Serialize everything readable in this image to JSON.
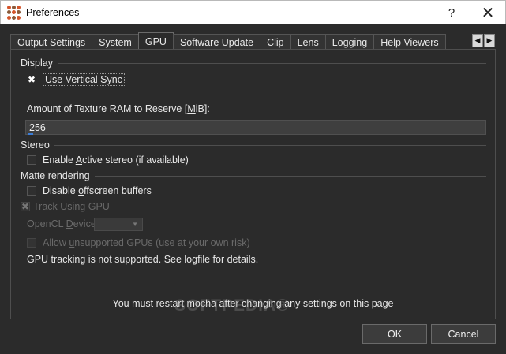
{
  "window": {
    "title": "Preferences",
    "help_glyph": "?",
    "close_glyph": "✕"
  },
  "tabs": [
    {
      "label": "Output Settings",
      "active": false
    },
    {
      "label": "System",
      "active": false
    },
    {
      "label": "GPU",
      "active": true
    },
    {
      "label": "Software Update",
      "active": false
    },
    {
      "label": "Clip",
      "active": false
    },
    {
      "label": "Lens",
      "active": false
    },
    {
      "label": "Logging",
      "active": false
    },
    {
      "label": "Help Viewers",
      "active": false
    }
  ],
  "tab_scroll": {
    "left_glyph": "◀",
    "right_glyph": "▶"
  },
  "display": {
    "section_label": "Display",
    "vsync": {
      "pre": "Use ",
      "accel": "V",
      "post": "ertical Sync",
      "checked": true
    }
  },
  "texture": {
    "label_pre": "Amount of Texture RAM to Reserve [",
    "label_accel": "M",
    "label_post": "iB]:",
    "value": "256"
  },
  "stereo": {
    "section_label": "Stereo",
    "active": {
      "pre": "Enable ",
      "accel": "A",
      "post": "ctive stereo (if available)",
      "checked": false
    }
  },
  "matte": {
    "section_label": "Matte rendering",
    "offscreen": {
      "pre": "Disable ",
      "accel": "o",
      "post": "ffscreen buffers",
      "checked": false
    }
  },
  "gpu_tracking": {
    "track": {
      "pre": "Track Using ",
      "accel": "G",
      "post": "PU",
      "checked": true,
      "enabled": false
    },
    "opencl_label_pre": "OpenCL ",
    "opencl_label_accel": "D",
    "opencl_label_post": "evice",
    "opencl_value": "",
    "allow_unsupported": {
      "pre": "Allow ",
      "accel": "u",
      "post": "nsupported GPUs (use at your own risk)",
      "checked": false,
      "enabled": false
    },
    "status_message": "GPU tracking is not supported. See logfile for details."
  },
  "restart_message": "You must restart mocha after changing any settings on this page",
  "watermark": "SOFTPEDIA®",
  "buttons": {
    "ok": "OK",
    "cancel": "Cancel"
  },
  "icons": {
    "app": "mocha-app-icon",
    "check": "✖"
  }
}
